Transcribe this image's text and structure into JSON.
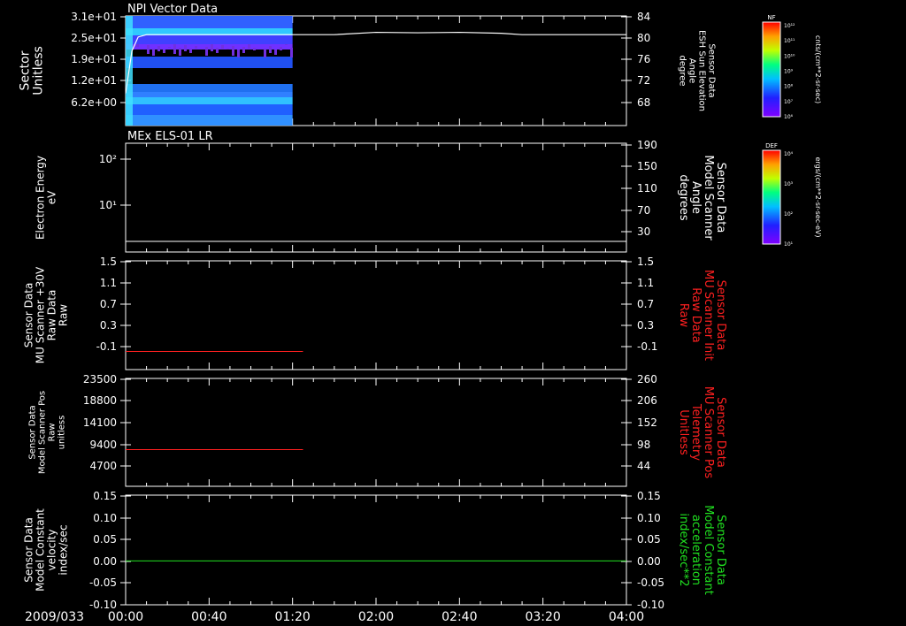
{
  "colors": {
    "background": "#000000",
    "axis": "#ffffff",
    "red": "#ff2020",
    "green": "#20e020"
  },
  "date_label": "2009/033",
  "x_ticks": [
    "00:00",
    "00:40",
    "01:20",
    "02:00",
    "02:40",
    "03:20",
    "04:00"
  ],
  "chart_data": [
    {
      "type": "heatmap",
      "title": "NPI Vector Data",
      "ylabel_left": [
        "Sector",
        "Unitless"
      ],
      "yticks_left": [
        "3.1e+01",
        "2.5e+01",
        "1.9e+01",
        "1.2e+01",
        "6.2e+00"
      ],
      "ylabel_right": [
        "Sensor Data",
        "ESH Sun Elevation",
        "Angle",
        "degree"
      ],
      "yticks_right": [
        "84",
        "80",
        "76",
        "72",
        "68"
      ],
      "ylim_right": [
        64,
        84
      ],
      "data_end": "01:20",
      "line": {
        "x": [
          "00:00",
          "00:03",
          "00:06",
          "00:10",
          "01:20",
          "01:40",
          "02:00",
          "02:20",
          "02:40",
          "03:00",
          "03:10",
          "04:00"
        ],
        "y": [
          67.5,
          76.5,
          79.5,
          80.0,
          80.0,
          80.0,
          80.5,
          80.4,
          80.5,
          80.3,
          80.0,
          80.0
        ]
      },
      "colorbar": {
        "label": "NF",
        "ticks": [
          "10¹²",
          "10¹¹",
          "10¹⁰",
          "10⁹",
          "10⁸",
          "10⁷",
          "10⁶"
        ],
        "units": "cnts/(cm**2-sr-sec)"
      }
    },
    {
      "type": "line",
      "title": "MEx ELS-01 LR",
      "ylabel_left": [
        "Electron Energy",
        "eV"
      ],
      "yticks_left": [
        "10²",
        "10¹"
      ],
      "ylabel_right": [
        "Sensor Data",
        "Model Scanner",
        "Angle",
        "degrees"
      ],
      "yticks_right": [
        "190",
        "150",
        "110",
        "70",
        "30"
      ],
      "ylim_right": [
        10,
        190
      ],
      "series": [
        {
          "x": [
            "00:00",
            "04:00"
          ],
          "y": [
            10,
            10
          ]
        }
      ],
      "colorbar": {
        "label": "DEF",
        "ticks": [
          "10⁴",
          "10³",
          "10²",
          "10¹"
        ],
        "units": "ergs/(cm**2-sr-sec-eV)"
      }
    },
    {
      "type": "line",
      "ylabel_left": [
        "Sensor Data",
        "MU Scanner +30V",
        "Raw Data",
        "Raw"
      ],
      "yticks_left": [
        "1.5",
        "1.1",
        "0.7",
        "0.3",
        "-0.1"
      ],
      "ylabel_right": [
        "Sensor Data",
        "MU Scanner Init",
        "Raw Data",
        "Raw"
      ],
      "yticks_right": [
        "1.5",
        "1.1",
        "0.7",
        "0.3",
        "-0.1"
      ],
      "ylim": [
        -0.3,
        1.5
      ],
      "series": [
        {
          "x": [
            "00:00",
            "01:25"
          ],
          "y": [
            0.0,
            0.0
          ]
        }
      ]
    },
    {
      "type": "line",
      "ylabel_left": [
        "Sensor Data",
        "Model Scanner Pos",
        "Raw",
        "unitless"
      ],
      "yticks_left": [
        "23500",
        "18800",
        "14100",
        "9400",
        "4700"
      ],
      "ylabel_right": [
        "Sensor Data",
        "MU Scanner Pos",
        "Telemetry",
        "Unitless"
      ],
      "yticks_right": [
        "260",
        "206",
        "152",
        "98",
        "44"
      ],
      "ylim": [
        0,
        23500
      ],
      "series": [
        {
          "x": [
            "00:00",
            "01:25"
          ],
          "y": [
            8000,
            8000
          ]
        }
      ]
    },
    {
      "type": "line",
      "ylabel_left": [
        "Sensor Data",
        "Model Constant",
        "velocity",
        "index/sec"
      ],
      "yticks_left": [
        "0.15",
        "0.10",
        "0.05",
        "0.00",
        "-0.05",
        "-0.10"
      ],
      "ylabel_right": [
        "Sensor Data",
        "Model Constant",
        "acceleration",
        "index/sec**2"
      ],
      "yticks_right": [
        "0.15",
        "0.10",
        "0.05",
        "0.00",
        "-0.05",
        "-0.10"
      ],
      "ylim": [
        -0.1,
        0.15
      ],
      "series": [
        {
          "x": [
            "00:00",
            "04:00"
          ],
          "y": [
            0.0,
            0.0
          ]
        }
      ]
    }
  ]
}
